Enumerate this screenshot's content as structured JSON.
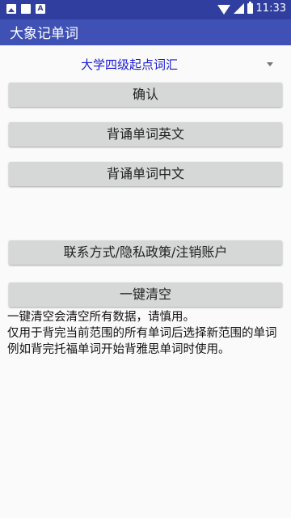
{
  "status_bar": {
    "time": "11:33",
    "left_icons": [
      "photo-icon",
      "square-icon",
      "a-box-icon"
    ],
    "right_icons": [
      "wifi-icon",
      "signal-icon",
      "battery-icon"
    ]
  },
  "app_bar": {
    "title": "大象记单词"
  },
  "spinner": {
    "selected": "大学四级起点词汇"
  },
  "buttons": {
    "confirm": "确认",
    "recite_english": "背诵单词英文",
    "recite_chinese": "背诵单词中文",
    "contact": "联系方式/隐私政策/注销账户",
    "clear_all": "一键清空"
  },
  "info": {
    "line1": "一键清空会清空所有数据，请慎用。",
    "line2": "仅用于背完当前范围的所有单词后选择新范围的单词例如背完托福单词开始背雅思单词时使用。"
  },
  "colors": {
    "status_bar": "#303f9f",
    "app_bar": "#3f51b5",
    "spinner_text": "#1a1ad6",
    "button_bg": "#d6d7d7"
  }
}
